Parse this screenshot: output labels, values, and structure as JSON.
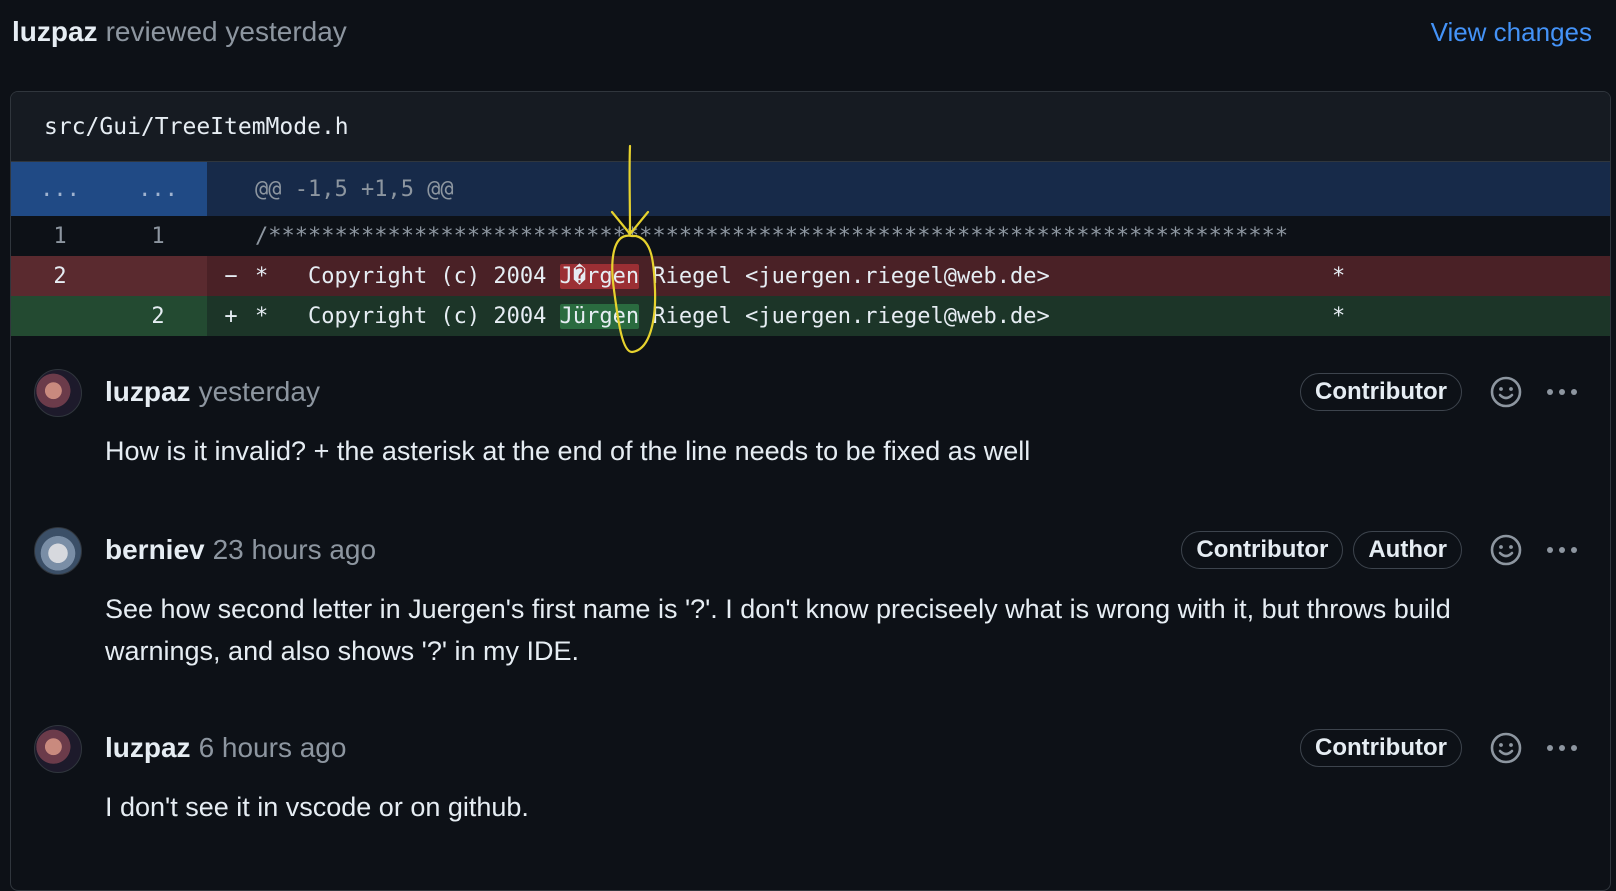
{
  "review": {
    "reviewer": "luzpaz",
    "action": "reviewed yesterday",
    "view_changes": "View changes"
  },
  "file": {
    "path": "src/Gui/TreeItemMode.h"
  },
  "diff": {
    "hunk": {
      "left": "...",
      "right": "...",
      "header": "@@ -1,5 +1,5 @@"
    },
    "context": {
      "left": "1",
      "right": "1",
      "code": "/*****************************************************************************"
    },
    "deleted": {
      "left": "2",
      "sign": "−",
      "prefix": "*   Copyright (c) 2004 ",
      "highlight": "J�rgen",
      "suffix": " Riegel <juergen.riegel@web.de>",
      "tail": "*"
    },
    "added": {
      "right": "2",
      "sign": "+",
      "prefix": "*   Copyright (c) 2004 ",
      "highlight": "Jürgen",
      "suffix": " Riegel <juergen.riegel@web.de>",
      "tail": "*"
    }
  },
  "comments": [
    {
      "author": "luzpaz",
      "time": "yesterday",
      "badges": [
        "Contributor"
      ],
      "body": "How is it invalid? + the asterisk at the end of the line needs to be fixed as well"
    },
    {
      "author": "berniev",
      "time": "23 hours ago",
      "badges": [
        "Contributor",
        "Author"
      ],
      "body": "See how second letter in Juergen's first name is '?'. I don't know preciseely what is wrong with it, but throws build warnings, and also shows '?' in my IDE."
    },
    {
      "author": "luzpaz",
      "time": "6 hours ago",
      "badges": [
        "Contributor"
      ],
      "body": "I don't see it in vscode or on github."
    }
  ],
  "icons": {
    "reaction": "smiley-icon",
    "more": "kebab-horizontal-icon"
  },
  "colors": {
    "background": "#0d1117",
    "link": "#4493f8",
    "deletion": "#4a2126",
    "addition": "#1c3528",
    "hunk": "#172a49",
    "annotation": "#e6d22e"
  }
}
